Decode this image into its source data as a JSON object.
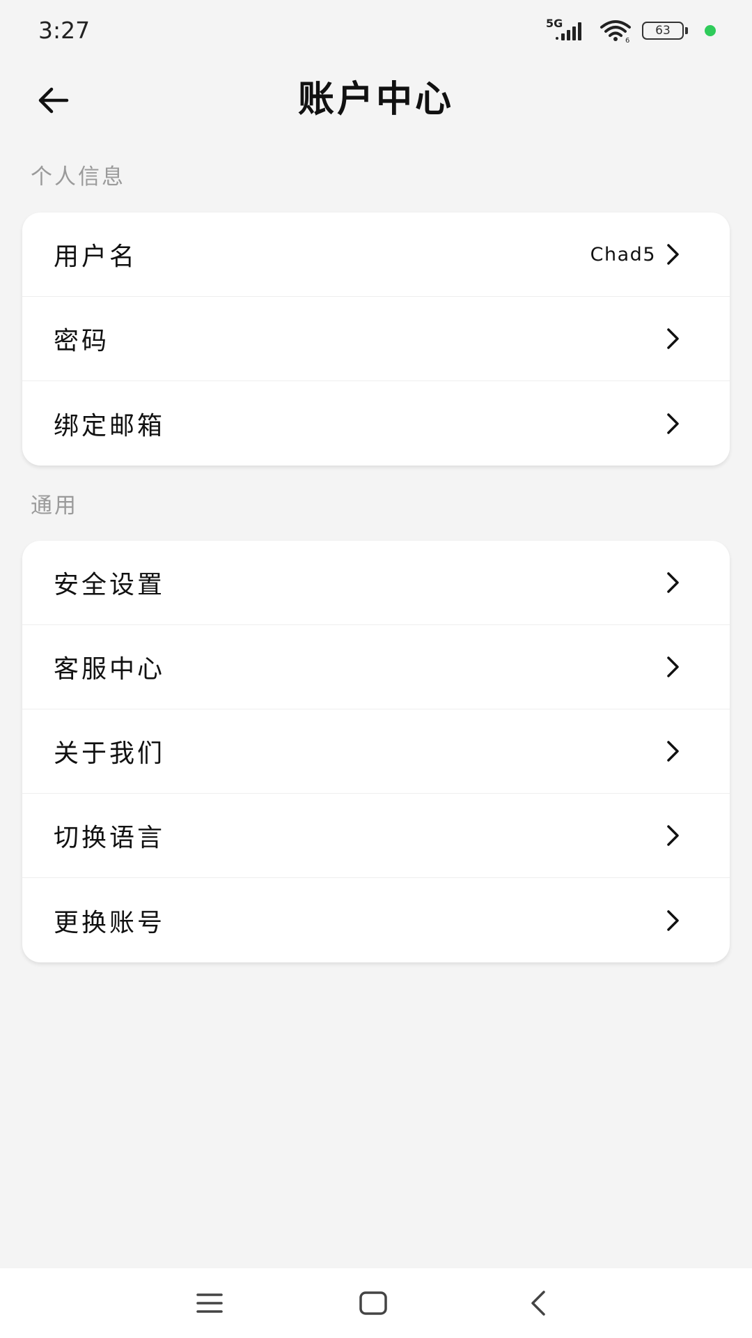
{
  "status_bar": {
    "time": "3:27",
    "network": "5G",
    "battery": "63",
    "icons": [
      "signal-icon",
      "wifi-icon",
      "battery-icon",
      "dot-indicator"
    ],
    "dot_color": "#2fcb5a"
  },
  "header": {
    "title": "账户中心",
    "back_icon": "arrow-left-icon"
  },
  "sections": [
    {
      "label": "个人信息",
      "rows": [
        {
          "label": "用户名",
          "value": "Chad5"
        },
        {
          "label": "密码"
        },
        {
          "label": "绑定邮箱"
        }
      ]
    },
    {
      "label": "通用",
      "rows": [
        {
          "label": "安全设置"
        },
        {
          "label": "客服中心"
        },
        {
          "label": "关于我们"
        },
        {
          "label": "切换语言"
        },
        {
          "label": "更换账号"
        }
      ]
    }
  ],
  "nav_bar": {
    "icons": [
      "menu-icon",
      "home-square-icon",
      "back-chevron-icon"
    ]
  },
  "colors": {
    "background": "#f4f4f4",
    "card": "#ffffff",
    "section_label": "#9a9a9a",
    "text": "#111111"
  }
}
